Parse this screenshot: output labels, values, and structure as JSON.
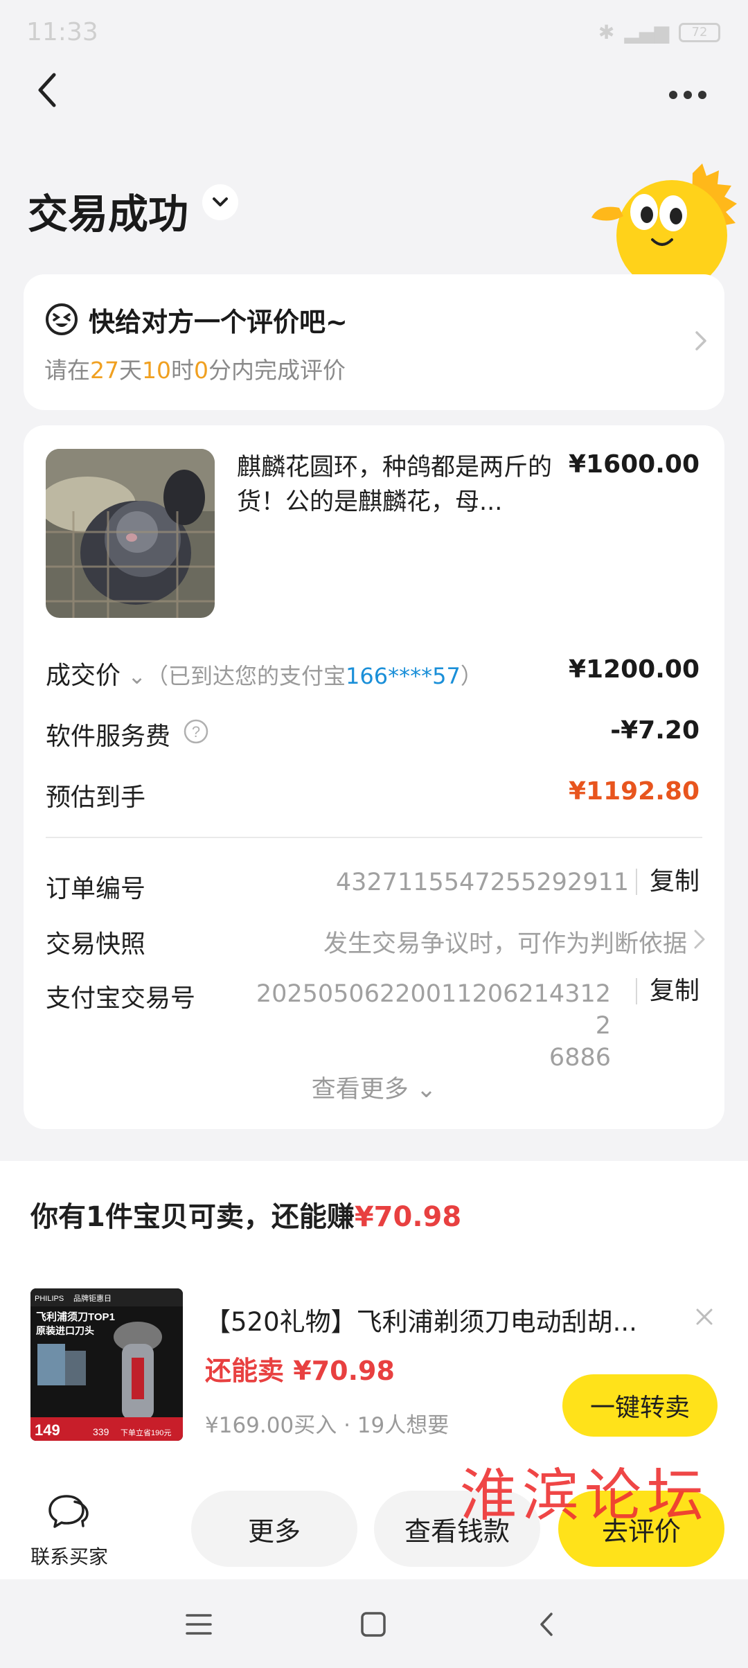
{
  "status_bar": {
    "time": "11:33",
    "battery": "72"
  },
  "header": {
    "title": "交易成功"
  },
  "review_card": {
    "title": "快给对方一个评价吧~",
    "sub_prefix": "请在",
    "days": "27",
    "days_unit": "天",
    "hours": "10",
    "hours_unit": "时",
    "minutes": "0",
    "sub_suffix": "分内完成评价"
  },
  "order": {
    "product_title": "麒麟花圆环，种鸽都是两斤的货！公的是麒麟花，母...",
    "product_price": "¥1600.00",
    "deal_price_label": "成交价",
    "deal_price_note_prefix": "（已到达您的支付宝",
    "deal_price_note_account": "166****57",
    "deal_price_note_suffix": "）",
    "deal_price": "¥1200.00",
    "service_fee_label": "软件服务费",
    "service_fee": "-¥7.20",
    "estimate_label": "预估到手",
    "estimate": "¥1192.80",
    "order_no_label": "订单编号",
    "order_no": "4327115547255292911",
    "copy_label": "复制",
    "snapshot_label": "交易快照",
    "snapshot_value": "发生交易争议时，可作为判断依据",
    "alipay_no_label": "支付宝交易号",
    "alipay_no_line1": "20250506220011206214312 2",
    "alipay_no_line2": "6886",
    "see_more": "查看更多"
  },
  "sell": {
    "heading_prefix": "你有1件宝贝可卖，还能赚",
    "heading_amount": "¥70.98",
    "ad_title": "【520礼物】飞利浦剃须刀电动刮胡...",
    "ad_price_label": "还能卖",
    "ad_price": "¥70.98",
    "ad_bought": "¥169.00买入",
    "ad_dot": "·",
    "ad_wants": "19人想要",
    "resell_button": "一键转卖",
    "ad_image_text": {
      "brand": "PHILIPS",
      "tag": "品牌钜惠日",
      "top": "飞利浦须刀TOP1",
      "sub": "原装进口刀头",
      "price": "149",
      "price2": "339",
      "promo": "下单立省190元"
    }
  },
  "bottom_bar": {
    "contact_label": "联系买家",
    "more": "更多",
    "view_money": "查看钱款",
    "review": "去评价"
  },
  "watermark": "淮滨论坛",
  "colors": {
    "accent_yellow": "#ffe21a",
    "price_red": "#e84040",
    "estimate_orange": "#e8551e",
    "countdown_orange": "#f0a020",
    "account_blue": "#1a8fd8"
  }
}
